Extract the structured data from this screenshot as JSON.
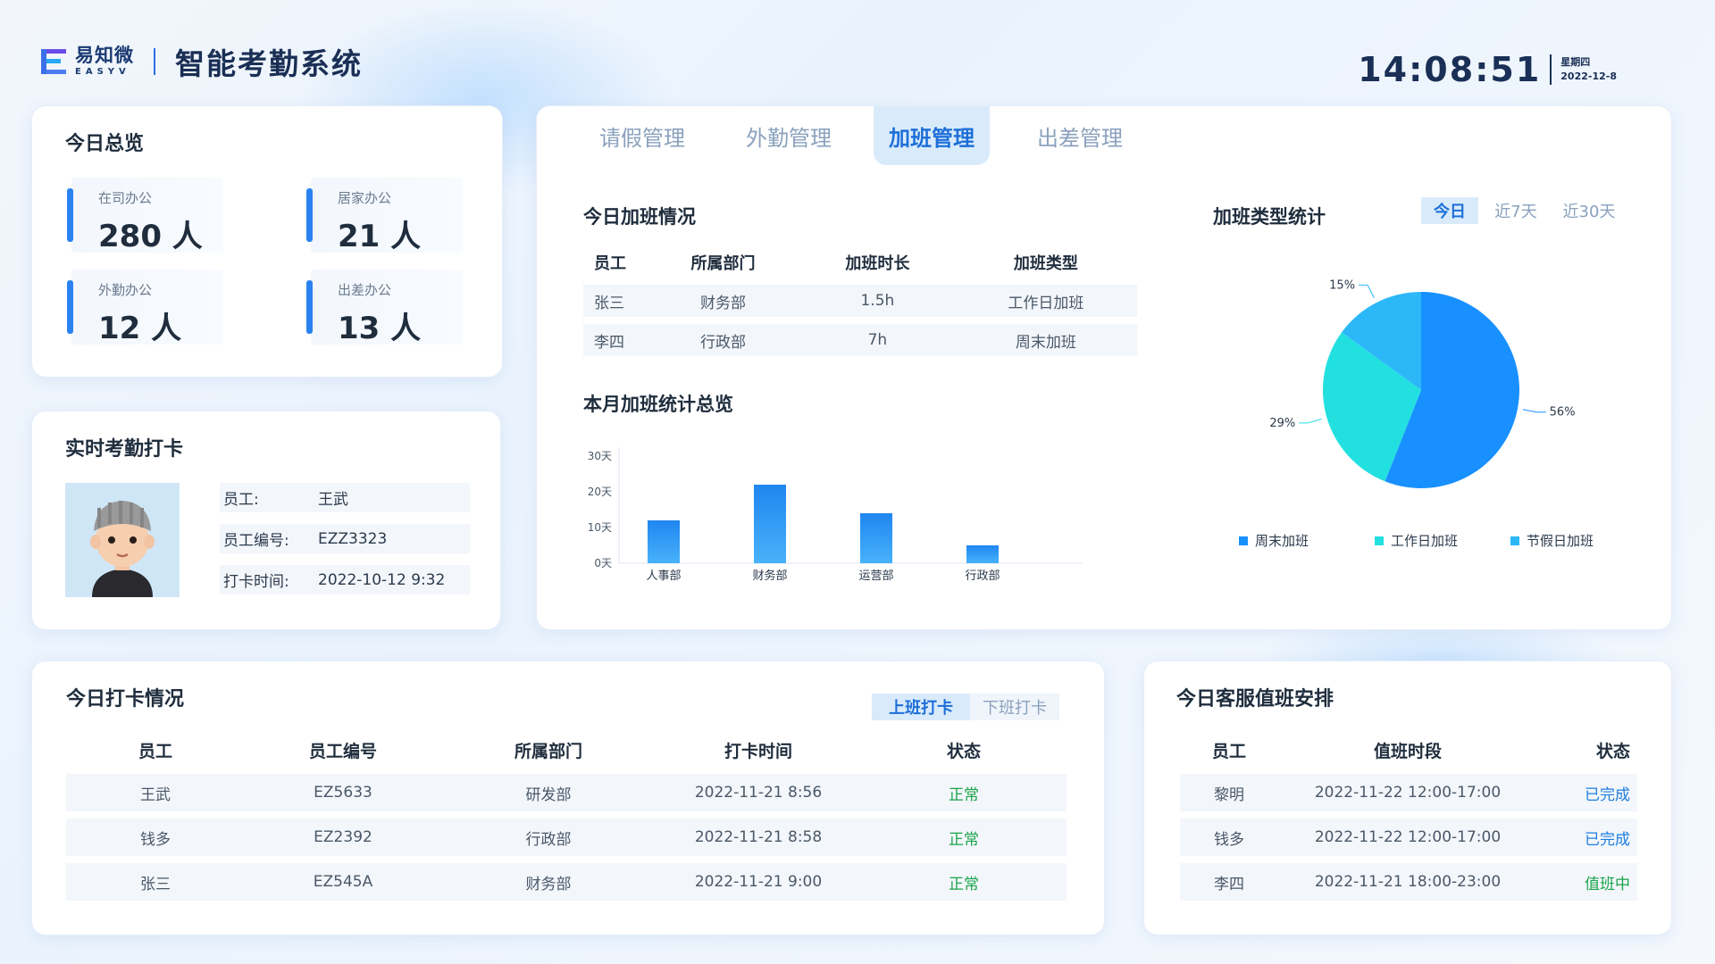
{
  "header": {
    "logo_cn": "易知微",
    "logo_en": "EASYV",
    "title": "智能考勤系统"
  },
  "clock": {
    "time": "14:08:51",
    "weekday": "星期四",
    "date": "2022-12-8"
  },
  "overview": {
    "title": "今日总览",
    "stats": [
      {
        "label": "在司办公",
        "value": "280 人"
      },
      {
        "label": "居家办公",
        "value": "21 人"
      },
      {
        "label": "外勤办公",
        "value": "12 人"
      },
      {
        "label": "出差办公",
        "value": "13 人"
      }
    ]
  },
  "checkin": {
    "title": "实时考勤打卡",
    "rows": [
      {
        "key": "员工:",
        "value": "王武"
      },
      {
        "key": "员工编号:",
        "value": "EZZ3323"
      },
      {
        "key": "打卡时间:",
        "value": "2022-10-12 9:32"
      }
    ]
  },
  "tabs": [
    {
      "label": "请假管理",
      "active": false
    },
    {
      "label": "外勤管理",
      "active": false
    },
    {
      "label": "加班管理",
      "active": true
    },
    {
      "label": "出差管理",
      "active": false
    }
  ],
  "overtime_today": {
    "title": "今日加班情况",
    "columns": [
      "员工",
      "所属部门",
      "加班时长",
      "加班类型"
    ],
    "rows": [
      [
        "张三",
        "财务部",
        "1.5h",
        "工作日加班"
      ],
      [
        "李四",
        "行政部",
        "7h",
        "周末加班"
      ]
    ]
  },
  "monthly": {
    "title": "本月加班统计总览"
  },
  "type_stats": {
    "title": "加班类型统计",
    "ranges": [
      {
        "label": "今日",
        "active": true
      },
      {
        "label": "近7天",
        "active": false
      },
      {
        "label": "近30天",
        "active": false
      }
    ]
  },
  "colors": {
    "accent": "#1e6fd8",
    "bar": "#2a8ef5",
    "pie_weekend": "#1890ff",
    "pie_workday": "#22e0e0",
    "pie_holiday": "#2cb8f8",
    "ok": "#1aa44a"
  },
  "chart_data": [
    {
      "type": "bar",
      "categories": [
        "人事部",
        "财务部",
        "运营部",
        "行政部"
      ],
      "values": [
        12,
        22,
        14,
        5
      ],
      "yticks": [
        "30天",
        "20天",
        "10天",
        "0天"
      ],
      "ylim": [
        0,
        30
      ],
      "grid": false
    },
    {
      "type": "pie",
      "series": [
        {
          "name": "周末加班",
          "value": 56,
          "label": "56%"
        },
        {
          "name": "工作日加班",
          "value": 29,
          "label": "29%"
        },
        {
          "name": "节假日加班",
          "value": 15,
          "label": "15%"
        }
      ],
      "legend": "bottom"
    }
  ],
  "clockin_today": {
    "title": "今日打卡情况",
    "toggle_on": "上班打卡",
    "toggle_off": "下班打卡",
    "columns": [
      "员工",
      "员工编号",
      "所属部门",
      "打卡时间",
      "状态"
    ],
    "rows": [
      [
        "王武",
        "EZ5633",
        "研发部",
        "2022-11-21 8:56",
        "正常"
      ],
      [
        "钱多",
        "EZ2392",
        "行政部",
        "2022-11-21 8:58",
        "正常"
      ],
      [
        "张三",
        "EZ545A",
        "财务部",
        "2022-11-21 9:00",
        "正常"
      ]
    ]
  },
  "duty": {
    "title": "今日客服值班安排",
    "columns": [
      "员工",
      "值班时段",
      "状态"
    ],
    "rows": [
      [
        "黎明",
        "2022-11-22 12:00-17:00",
        "已完成"
      ],
      [
        "钱多",
        "2022-11-22 12:00-17:00",
        "已完成"
      ],
      [
        "李四",
        "2022-11-21 18:00-23:00",
        "值班中"
      ]
    ]
  }
}
